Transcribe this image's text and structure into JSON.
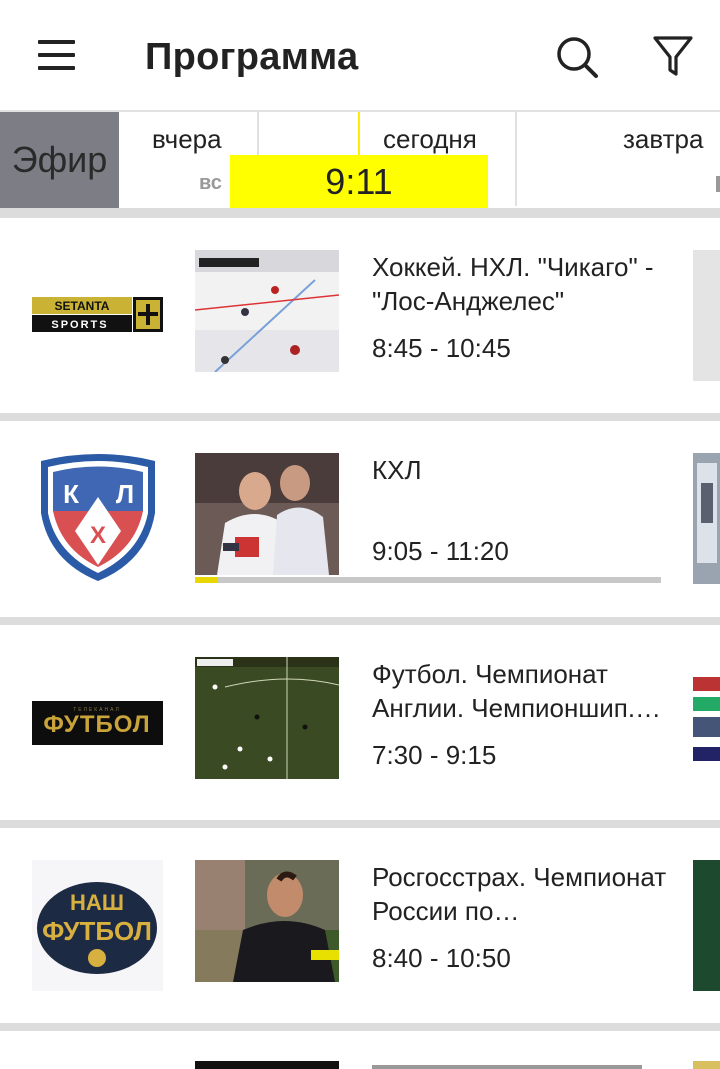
{
  "header": {
    "title": "Программа",
    "menu_icon": "hamburger-icon",
    "search_icon": "search-icon",
    "filter_icon": "filter-icon"
  },
  "days": {
    "live_label": "Эфир",
    "yesterday": {
      "label": "вчера",
      "weekday": "вс"
    },
    "today": {
      "label": "сегодня"
    },
    "tomorrow": {
      "label": "завтра"
    },
    "current_time": "9:11"
  },
  "programs": [
    {
      "channel_logo": "setanta-sports-plus-logo",
      "title": "Хоккей. НХЛ. \"Чикаго\" - \"Лос-Анджелес\"",
      "time": "8:45 - 10:45"
    },
    {
      "channel_logo": "khl-logo",
      "title": "КХЛ",
      "time": "9:05 - 11:20",
      "progress": 0.05
    },
    {
      "channel_logo": "futbol-logo",
      "title": "Футбол. Чемпионат Англии. Чемпионшип.…",
      "time": "7:30 - 9:15"
    },
    {
      "channel_logo": "nash-futbol-logo",
      "title": "Росгосстрах. Чемпионат России по…",
      "time": "8:40 - 10:50"
    }
  ],
  "colors": {
    "accent": "#ffff00",
    "live_tab": "#7d7d85",
    "divider": "#dcdcdc"
  }
}
